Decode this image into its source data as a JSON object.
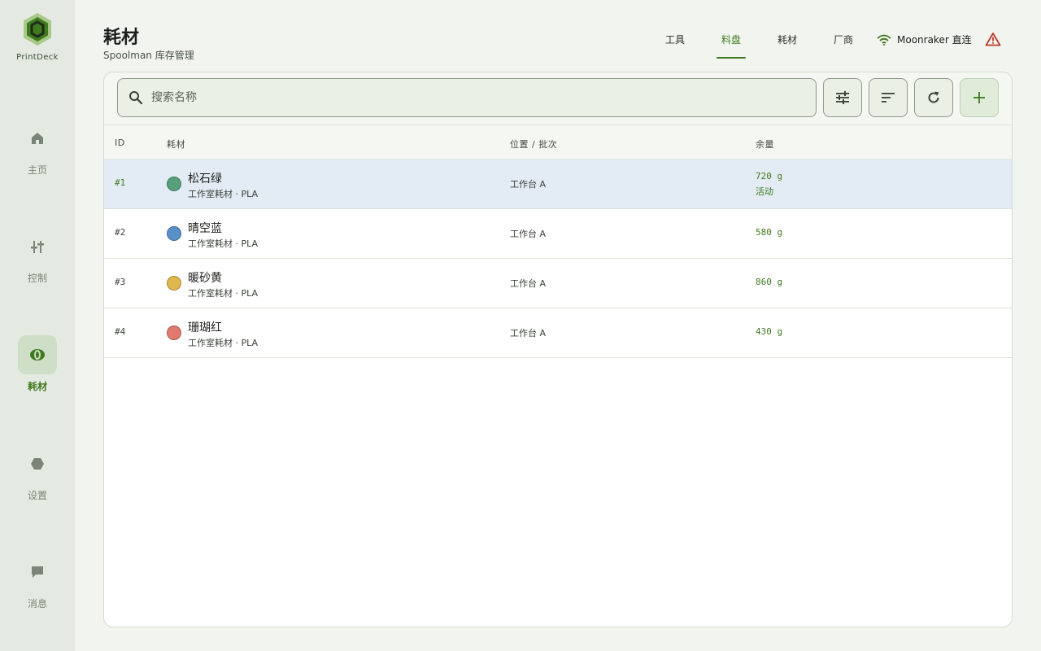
{
  "brand": {
    "name": "PrintDeck"
  },
  "sidebar": {
    "items": [
      {
        "label": "主页",
        "icon": "home-icon",
        "active": false
      },
      {
        "label": "控制",
        "icon": "sliders-icon",
        "active": false
      },
      {
        "label": "耗材",
        "icon": "filament-spool-icon",
        "active": true
      },
      {
        "label": "设置",
        "icon": "hexagon-settings-icon",
        "active": false
      },
      {
        "label": "消息",
        "icon": "chat-bubble-icon",
        "active": false
      }
    ]
  },
  "header": {
    "title": "耗材",
    "subtitle": "Spoolman 库存管理",
    "tabs": [
      {
        "label": "工具",
        "active": false
      },
      {
        "label": "料盘",
        "active": true
      },
      {
        "label": "耗材",
        "active": false
      },
      {
        "label": "厂商",
        "active": false
      }
    ],
    "connection": "Moonraker 直连"
  },
  "search": {
    "placeholder": "搜索名称",
    "value": ""
  },
  "table": {
    "columns": {
      "id": "ID",
      "filament": "耗材",
      "location": "位置 / 批次",
      "remaining": "余量"
    },
    "rows": [
      {
        "id": "#1",
        "name": "松石绿",
        "meta": "工作室耗材 · PLA",
        "location": "工作台 A",
        "remaining": "720 g",
        "status": "活动",
        "color": "#57a07b",
        "selected": true
      },
      {
        "id": "#2",
        "name": "晴空蓝",
        "meta": "工作室耗材 · PLA",
        "location": "工作台 A",
        "remaining": "580 g",
        "status": "",
        "color": "#5a90c8",
        "selected": false
      },
      {
        "id": "#3",
        "name": "暖砂黄",
        "meta": "工作室耗材 · PLA",
        "location": "工作台 A",
        "remaining": "860 g",
        "status": "",
        "color": "#e0b64f",
        "selected": false
      },
      {
        "id": "#4",
        "name": "珊瑚红",
        "meta": "工作室耗材 · PLA",
        "location": "工作台 A",
        "remaining": "430 g",
        "status": "",
        "color": "#e07a70",
        "selected": false
      }
    ]
  },
  "colors": {
    "accent": "#3f7a1f",
    "warning": "#c0392b"
  }
}
